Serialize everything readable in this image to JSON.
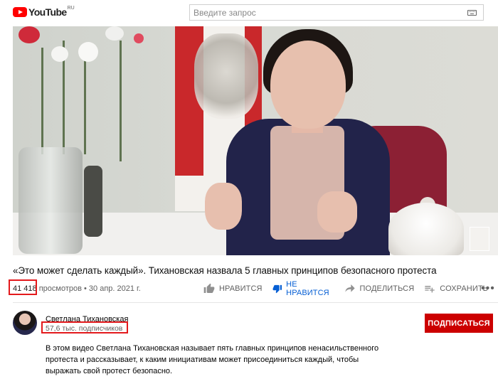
{
  "header": {
    "logo_text": "YouTube",
    "logo_region": "RU",
    "search_placeholder": "Введите запрос",
    "keyboard_icon": "keyboard-icon"
  },
  "video": {
    "title": "«Это может сделать каждый». Тихановская назвала 5 главных принципов безопасного протеста",
    "views_count": "41 418",
    "views_label": " просмотров",
    "date": " • 30 апр. 2021 г.",
    "highlight_color": "#e3191c"
  },
  "actions": {
    "like_label": "НРАВИТСЯ",
    "dislike_label": "НЕ НРАВИТСЯ",
    "share_label": "ПОДЕЛИТЬСЯ",
    "save_label": "СОХРАНИТЬ",
    "more_label": "•••",
    "active_color": "#065fd4"
  },
  "channel": {
    "name": "Светлана Тихановская",
    "subscribers": "57,6 тыс. подписчиков",
    "subscribe_label": "ПОДПИСАТЬСЯ",
    "subscribe_color": "#cc0000"
  },
  "description": {
    "lines": [
      "В этом видео Светлана Тихановская называет пять главных принципов ненасильственного",
      "протеста и рассказывает, к каким инициативам может присоединиться каждый, чтобы",
      "выражать свой протест безопасно."
    ]
  }
}
